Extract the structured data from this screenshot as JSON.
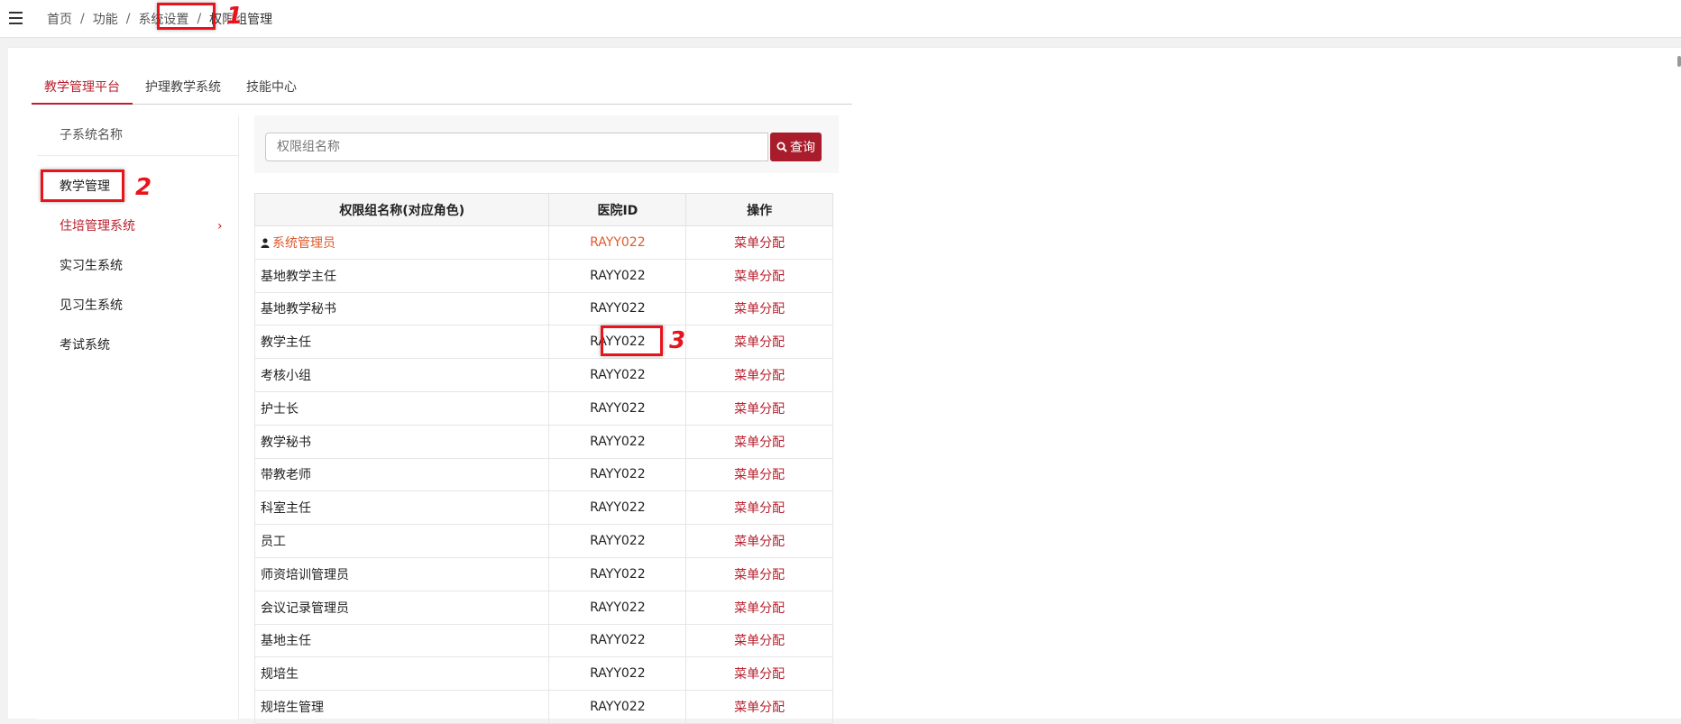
{
  "breadcrumb": {
    "items": [
      "首页",
      "功能",
      "系统设置"
    ],
    "current": "权限组管理",
    "separator": "/"
  },
  "tabs": [
    "教学管理平台",
    "护理教学系统",
    "技能中心"
  ],
  "sidebar": {
    "header": "子系统名称",
    "items": [
      "教学管理",
      "住培管理系统",
      "实习生系统",
      "见习生系统",
      "考试系统"
    ]
  },
  "search": {
    "placeholder": "权限组名称",
    "button_label": "查询"
  },
  "table": {
    "headers": [
      "权限组名称(对应角色)",
      "医院ID",
      "操作"
    ],
    "rows": [
      {
        "name": "系统管理员",
        "hospital_id": "RAYY022",
        "action": "菜单分配"
      },
      {
        "name": "基地教学主任",
        "hospital_id": "RAYY022",
        "action": "菜单分配"
      },
      {
        "name": "基地教学秘书",
        "hospital_id": "RAYY022",
        "action": "菜单分配"
      },
      {
        "name": "教学主任",
        "hospital_id": "RAYY022",
        "action": "菜单分配"
      },
      {
        "name": "考核小组",
        "hospital_id": "RAYY022",
        "action": "菜单分配"
      },
      {
        "name": "护士长",
        "hospital_id": "RAYY022",
        "action": "菜单分配"
      },
      {
        "name": "教学秘书",
        "hospital_id": "RAYY022",
        "action": "菜单分配"
      },
      {
        "name": "带教老师",
        "hospital_id": "RAYY022",
        "action": "菜单分配"
      },
      {
        "name": "科室主任",
        "hospital_id": "RAYY022",
        "action": "菜单分配"
      },
      {
        "name": "员工",
        "hospital_id": "RAYY022",
        "action": "菜单分配"
      },
      {
        "name": "师资培训管理员",
        "hospital_id": "RAYY022",
        "action": "菜单分配"
      },
      {
        "name": "会议记录管理员",
        "hospital_id": "RAYY022",
        "action": "菜单分配"
      },
      {
        "name": "基地主任",
        "hospital_id": "RAYY022",
        "action": "菜单分配"
      },
      {
        "name": "规培生",
        "hospital_id": "RAYY022",
        "action": "菜单分配"
      },
      {
        "name": "规培生管理",
        "hospital_id": "RAYY022",
        "action": "菜单分配"
      }
    ]
  },
  "annotations": [
    "1",
    "2",
    "3"
  ],
  "colors": {
    "accent": "#b8212e",
    "highlight": "#e8141c",
    "admin_text": "#e05a2b"
  }
}
